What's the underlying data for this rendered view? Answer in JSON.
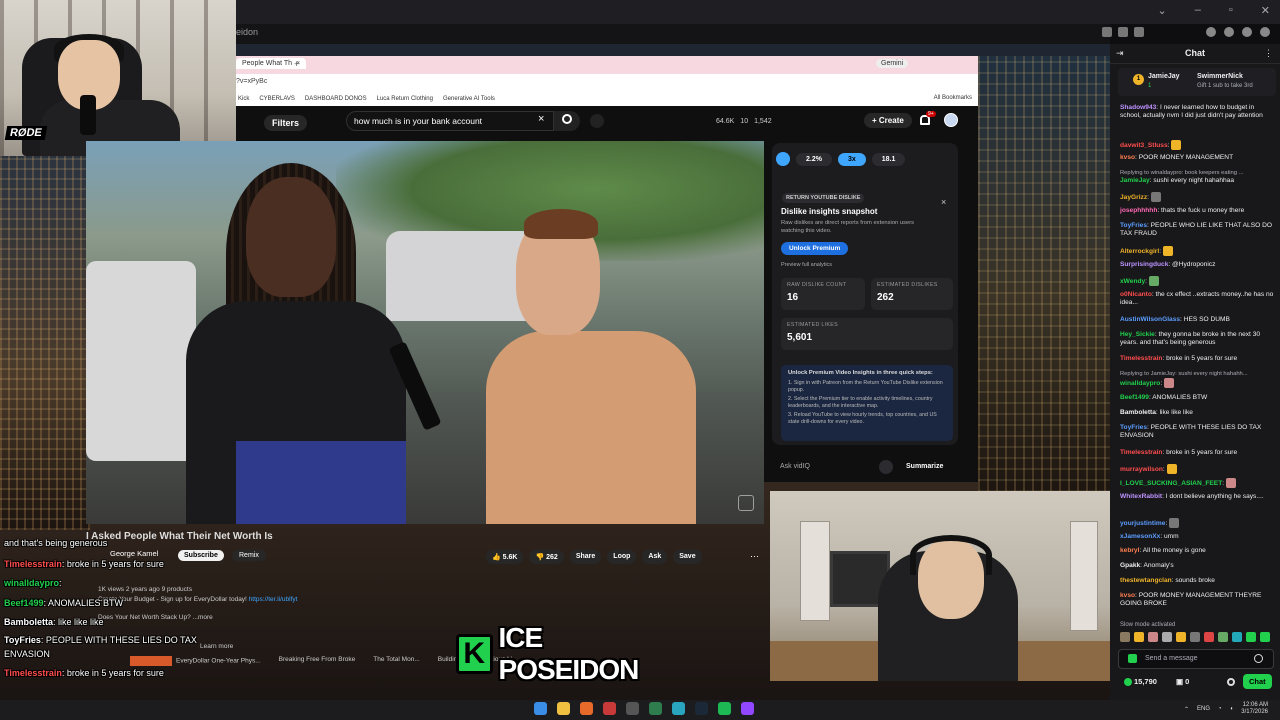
{
  "browser": {
    "tab_title": "People What Th",
    "url": "?v=xPyBc",
    "tab_title_short": "eidon",
    "bookmarks": [
      "Kick",
      "CYBERLAVS",
      "DASHBOARD DONOS",
      "Luca Return Clothing",
      "Generative AI Tools"
    ],
    "all_bookmarks": "All Bookmarks",
    "gemini": "Gemini"
  },
  "youtube": {
    "filters": "Filters",
    "search_query": "how much is in your bank account",
    "stats": [
      "64.6K",
      "10",
      "1,542"
    ],
    "create": "Create",
    "notif_count": "9+"
  },
  "video": {
    "title": "I Asked People What Their Net Worth Is",
    "channel": "George Kamel",
    "subscribe": "Subscribe",
    "remix": "Remix",
    "likes": "5.6K",
    "dislikes": "262",
    "share": "Share",
    "loop": "Loop",
    "ask": "Ask",
    "save": "Save",
    "views_line": "1K views  2 years ago  9 products",
    "desc_line1": "Create Your Budget - Sign up for EveryDollar today!",
    "desc_link": "https://ter.li/ublfyt",
    "desc_line2": "Does Your Net Worth Stack Up?",
    "desc_more": "...more",
    "learn_more": "Learn more",
    "related": [
      "EveryDollar One-Year Phys...",
      "Breaking Free From Broke",
      "The Total Mon...",
      "Building a Non-Anxious Li..."
    ]
  },
  "rtd": {
    "speeds": [
      "2.2%",
      "3x",
      "18.1"
    ],
    "badge": "RETURN YOUTUBE DISLIKE",
    "title": "Dislike insights snapshot",
    "desc": "Raw dislikes are direct reports from extension users watching this video.",
    "unlock": "Unlock Premium",
    "preview": "Preview full analytics",
    "raw_label": "RAW DISLIKE COUNT",
    "raw_value": "16",
    "est_dislikes_label": "ESTIMATED DISLIKES",
    "est_dislikes_value": "262",
    "est_likes_label": "ESTIMATED LIKES",
    "est_likes_value": "5,601",
    "steps_title": "Unlock Premium Video Insights in three quick steps:",
    "steps": [
      "1. Sign in with Patreon from the Return YouTube Dislike extension popup.",
      "2. Select the Premium tier to enable activity timelines, country leaderboards, and the interactive map.",
      "3. Reload YouTube to view hourly trends, top countries, and US state drill-downs for every video."
    ],
    "ask_vidiq": "Ask vidIQ",
    "summarize": "Summarize"
  },
  "overlay_chat": [
    {
      "user": "",
      "text": "and that's being generous",
      "color": "#ffffff"
    },
    {
      "user": "Timelesstrain",
      "text": ": broke in 5 years for sure",
      "color": "#ff4d4d"
    },
    {
      "user": "winalldaypro",
      "text": ":",
      "color": "#21d04c"
    },
    {
      "user": "Beef1499",
      "text": ": ANOMALIES BTW",
      "color": "#21d04c"
    },
    {
      "user": "Bamboletta",
      "text": ": like like like",
      "color": "#ffffff"
    },
    {
      "user": "ToyFries",
      "text": ": PEOPLE WITH THESE LIES DO TAX",
      "color": "#ffffff"
    },
    {
      "user": "",
      "text": "ENVASION",
      "color": "#ffffff"
    },
    {
      "user": "Timelesstrain",
      "text": ": broke in 5 years for sure",
      "color": "#ff4d4d"
    }
  ],
  "logo": {
    "letter": "K",
    "text": "ICE POSEIDON"
  },
  "taskbar": {
    "lang": "ENG",
    "time": "12:06 AM",
    "date": "3/17/2026"
  },
  "chat": {
    "title": "Chat",
    "gift_user1": "JamieJay",
    "gift_count": "1",
    "gift_user2": "SwimmerNick",
    "gift_note": "Gift 1 sub to take 3rd",
    "messages": [
      {
        "user": "Shadow943",
        "color": "#bf94ff",
        "text": ": I never learned how to budget in school, actually nvm I did just didn't pay attention"
      },
      {
        "user": "davwit3_Stluss",
        "color": "#ff4d4d",
        "text": ":"
      },
      {
        "user": "kvso",
        "color": "#ff7f50",
        "text": ": POOR MONEY MANAGEMENT"
      },
      {
        "reply": "Replying to winaldaypro: book keepers eating ...",
        "user": "JamieJay",
        "color": "#21d04c",
        "text": ": sushi every night hahahhaa"
      },
      {
        "user": "JayGrizz",
        "color": "#f0b429",
        "text": ":"
      },
      {
        "user": "josephhhhh",
        "color": "#ff69b4",
        "text": ": thats the fuck u money there"
      },
      {
        "user": "ToyFries",
        "color": "#5c9eff",
        "text": ": PEOPLE WHO LIE LIKE THAT ALSO DO TAX FRAUD"
      },
      {
        "user": "Alterrockgirl",
        "color": "#f0b429",
        "text": ":"
      },
      {
        "user": "Surprisingduck",
        "color": "#bf94ff",
        "text": ": @Hydroponicz"
      },
      {
        "user": "xWendy",
        "color": "#21d04c",
        "text": ":"
      },
      {
        "user": "o0Nicanto",
        "color": "#ff4d4d",
        "text": ": the cx effect ..extracts money..he has no idea..."
      },
      {
        "user": "AustinWilsonGlass",
        "color": "#5c9eff",
        "text": ": HES SO DUMB"
      },
      {
        "user": "Hey_Sickie",
        "color": "#21d04c",
        "text": ": they gonna be broke in the next 30 years. and that's being generous"
      },
      {
        "user": "Timelesstrain",
        "color": "#ff4d4d",
        "text": ": broke in 5 years for sure"
      },
      {
        "reply": "Replying to JamieJay: sushi every night hahahh...",
        "user": "winalldaypro",
        "color": "#21d04c",
        "text": ":"
      },
      {
        "user": "Beef1499",
        "color": "#21d04c",
        "text": ": ANOMALIES BTW"
      },
      {
        "user": "Bamboletta",
        "color": "#efeff1",
        "text": ": like like like"
      },
      {
        "user": "ToyFries",
        "color": "#5c9eff",
        "text": ": PEOPLE WITH THESE LIES DO TAX ENVASION"
      },
      {
        "user": "Timelesstrain",
        "color": "#ff4d4d",
        "text": ": broke in 5 years for sure"
      },
      {
        "user": "murraywilson",
        "color": "#ff4d4d",
        "text": ":"
      },
      {
        "user": "I_LOVE_SUCKING_ASIAN_FEET",
        "color": "#21d04c",
        "text": ":"
      },
      {
        "user": "WhitexRabbit",
        "color": "#bf94ff",
        "text": ": I dont believe anything he says...."
      },
      {
        "user": "yourjustintime",
        "color": "#5c9eff",
        "text": ":"
      },
      {
        "user": "xJamesonXx",
        "color": "#5c9eff",
        "text": ": umm"
      },
      {
        "user": "kebryl",
        "color": "#ff7f50",
        "text": ": All the money is gone"
      },
      {
        "user": "Gpakk",
        "color": "#efeff1",
        "text": ": Anomaly's"
      },
      {
        "user": "thestewtangclan",
        "color": "#f0b429",
        "text": ": sounds broke"
      },
      {
        "user": "kvso",
        "color": "#ff7f50",
        "text": ": POOR MONEY MANAGEMENT THEYRE GOING BROKE"
      }
    ],
    "slow_mode": "Slow mode activated",
    "input_placeholder": "Send a message",
    "points": "15,790",
    "bits": "0",
    "chat_button": "Chat"
  },
  "colors": {
    "twitch_green": "#21d04c",
    "yt_blue": "#3ea6ff",
    "bg": "#0e0e10"
  }
}
